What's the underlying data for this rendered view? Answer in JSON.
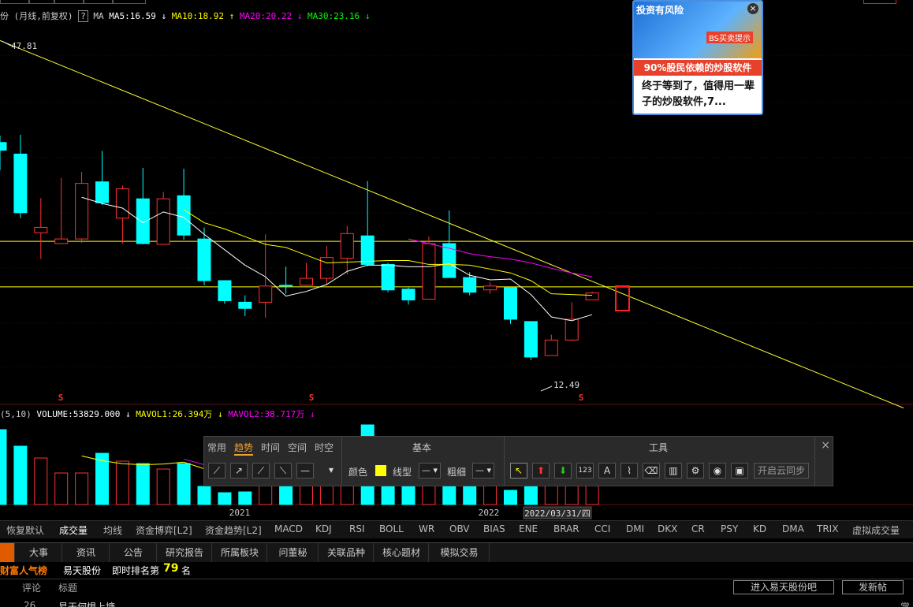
{
  "header": {
    "left_fragment": "份",
    "params": "(月线,前复权)",
    "help": "?",
    "ma_label": "MA",
    "ma5": "MA5:16.59",
    "ma10": "MA10:18.92",
    "ma20": "MA20:20.22",
    "ma30": "MA30:23.16",
    "arrow_down": "↓",
    "arrow_up": "↑"
  },
  "price_labels": {
    "high": "47.81",
    "low": "12.49"
  },
  "volume_header": {
    "params": "(5,10)",
    "volume": "VOLUME:53829.000",
    "mavol1": "MAVOL1:26.394万",
    "mavol2": "MAVOL2:38.717万",
    "arrow_down": "↓"
  },
  "markers": {
    "s": "S"
  },
  "x_axis": {
    "y2021": "2021",
    "y2022": "2022",
    "cursor_date": "2022/03/31/四"
  },
  "ad_popup": {
    "risk": "投资有风险",
    "tip": "BS买卖提示",
    "close": "×",
    "headline": "90%股民依赖的炒股软件",
    "body": "终于等到了，值得用一辈子的炒股软件,7..."
  },
  "draw_panel": {
    "tabs": [
      "常用",
      "趋势",
      "时间",
      "空间",
      "时空"
    ],
    "active_tab": "趋势",
    "section_basic": "基本",
    "section_tools": "工具",
    "color_label": "颜色",
    "linetype_label": "线型",
    "thickness_label": "粗细",
    "cloud_sync": "开启云同步",
    "tool_123": "123",
    "tool_a": "A",
    "close": "×",
    "color_swatch": "#ffff00"
  },
  "indicator_bar": [
    "恢复默认",
    "成交量",
    "均线",
    "资金博弈[L2]",
    "资金趋势[L2]",
    "MACD",
    "KDJ",
    "RSI",
    "BOLL",
    "WR",
    "OBV",
    "BIAS",
    "ENE",
    "BRAR",
    "CCI",
    "DMI",
    "DKX",
    "CR",
    "PSY",
    "KD",
    "DMA",
    "TRIX",
    "虚拟成交量"
  ],
  "info_tabs": [
    "大事",
    "资讯",
    "公告",
    "研究报告",
    "所属板块",
    "问董秘",
    "关联品种",
    "核心题材",
    "模拟交易"
  ],
  "rank": {
    "title": "财富人气榜",
    "stock": "易天股份",
    "prefix": "即时排名第",
    "number": "79",
    "suffix": "名"
  },
  "forum": {
    "col_comment": "评论",
    "col_title": "标题",
    "btn_enter": "进入易天股份吧",
    "btn_post": "发新帖",
    "row_count": "26",
    "row_title": "易天何惧上塘",
    "row_right": "掌"
  },
  "colors": {
    "up": "#ff3232",
    "down": "#00ffff",
    "ma5": "#ffffff",
    "ma10": "#ffff00",
    "ma20": "#ff00ff",
    "ma30": "#00ff00",
    "hline": "#ffff00"
  },
  "chart_data": {
    "type": "candlestick",
    "period": "monthly",
    "candles": [
      {
        "o": 34.6,
        "c": 33.6,
        "h": 35.5,
        "l": 31.0
      },
      {
        "o": 33.1,
        "c": 25.5,
        "h": 35.6,
        "l": 24.8
      },
      {
        "o": 22.9,
        "c": 23.6,
        "h": 27.4,
        "l": 19.5
      },
      {
        "o": 21.5,
        "c": 22.1,
        "h": 30.0,
        "l": 21.5
      },
      {
        "o": 22.1,
        "c": 29.3,
        "h": 30.8,
        "l": 21.6
      },
      {
        "o": 29.5,
        "c": 26.8,
        "h": 33.5,
        "l": 26.5
      },
      {
        "o": 24.8,
        "c": 28.6,
        "h": 29.0,
        "l": 21.5
      },
      {
        "o": 27.3,
        "c": 21.5,
        "h": 31.3,
        "l": 21.4
      },
      {
        "o": 21.4,
        "c": 27.3,
        "h": 28.2,
        "l": 21.4
      },
      {
        "o": 27.7,
        "c": 22.6,
        "h": 31.2,
        "l": 22.0
      },
      {
        "o": 22.1,
        "c": 16.7,
        "h": 23.6,
        "l": 16.1
      },
      {
        "o": 16.7,
        "c": 14.1,
        "h": 16.7,
        "l": 13.7
      },
      {
        "o": 13.9,
        "c": 13.1,
        "h": 14.8,
        "l": 12.1
      },
      {
        "o": 13.9,
        "c": 16.0,
        "h": 22.7,
        "l": 11.9
      },
      {
        "o": 16.1,
        "c": 16.0,
        "h": 18.5,
        "l": 15.0
      },
      {
        "o": 16.1,
        "c": 17.0,
        "h": 19.0,
        "l": 16.0
      },
      {
        "o": 17.0,
        "c": 19.7,
        "h": 21.2,
        "l": 16.2
      },
      {
        "o": 19.6,
        "c": 22.8,
        "h": 23.8,
        "l": 17.5
      },
      {
        "o": 22.5,
        "c": 18.8,
        "h": 29.6,
        "l": 18.6
      },
      {
        "o": 18.8,
        "c": 15.5,
        "h": 19.0,
        "l": 15.2
      },
      {
        "o": 15.6,
        "c": 14.2,
        "h": 15.8,
        "l": 13.6
      },
      {
        "o": 14.3,
        "c": 21.5,
        "h": 22.4,
        "l": 14.3
      },
      {
        "o": 21.5,
        "c": 17.1,
        "h": 25.8,
        "l": 17.1
      },
      {
        "o": 17.1,
        "c": 15.2,
        "h": 17.8,
        "l": 14.8
      },
      {
        "o": 15.5,
        "c": 16.0,
        "h": 16.5,
        "l": 15.0
      },
      {
        "o": 15.8,
        "c": 11.7,
        "h": 15.8,
        "l": 11.1
      },
      {
        "o": 11.4,
        "c": 6.8,
        "h": 11.4,
        "l": 6.4
      },
      {
        "o": 7.0,
        "c": 9.0,
        "h": 9.7,
        "l": 7.0
      },
      {
        "o": 9.0,
        "c": 11.7,
        "h": 13.9,
        "l": 8.9
      },
      {
        "o": 14.2,
        "c": 15.1,
        "h": 15.3,
        "l": 14.2
      }
    ],
    "volume": [
      9.5,
      7.4,
      5.9,
      4.0,
      4.0,
      6.5,
      5.5,
      5.2,
      4.5,
      5.2,
      2.3,
      1.5,
      1.6,
      4.5,
      4.4,
      3.9,
      5.6,
      6.7,
      10.1,
      6.0,
      4.0,
      3.8,
      6.4,
      3.2,
      4.2,
      1.8,
      2.7,
      4.2,
      3.9,
      2.4
    ],
    "ma5": [
      null,
      null,
      null,
      null,
      27.5,
      26.7,
      26.1,
      24.2,
      25.6,
      24.9,
      22.7,
      20.7,
      18.7,
      17.2,
      14.7,
      15.3,
      16.2,
      17.9,
      18.7,
      18.7,
      18.5,
      18.5,
      18.9,
      17.4,
      16.8,
      16.9,
      14.9,
      12.0,
      11.5,
      12.3
    ],
    "ma10": [
      null,
      null,
      null,
      null,
      null,
      null,
      null,
      null,
      null,
      25.9,
      24.2,
      23.4,
      22.4,
      21.4,
      21.0,
      20.0,
      19.0,
      19.1,
      19.2,
      19.3,
      19.3,
      18.8,
      18.8,
      18.7,
      18.2,
      17.7,
      16.7,
      15.0,
      14.9,
      14.8
    ],
    "ma20": [
      null,
      null,
      null,
      null,
      null,
      null,
      null,
      null,
      null,
      null,
      null,
      null,
      null,
      null,
      null,
      null,
      null,
      null,
      null,
      null,
      22.1,
      21.5,
      20.9,
      20.2,
      19.8,
      19.5,
      19.0,
      18.3,
      17.7,
      17.2
    ],
    "trendline": {
      "from_price": 47.81,
      "to_price": 0.2,
      "slope": "descending"
    },
    "horizontal_lines": [
      21.8,
      15.9
    ],
    "ylim": [
      2.5,
      50
    ]
  }
}
